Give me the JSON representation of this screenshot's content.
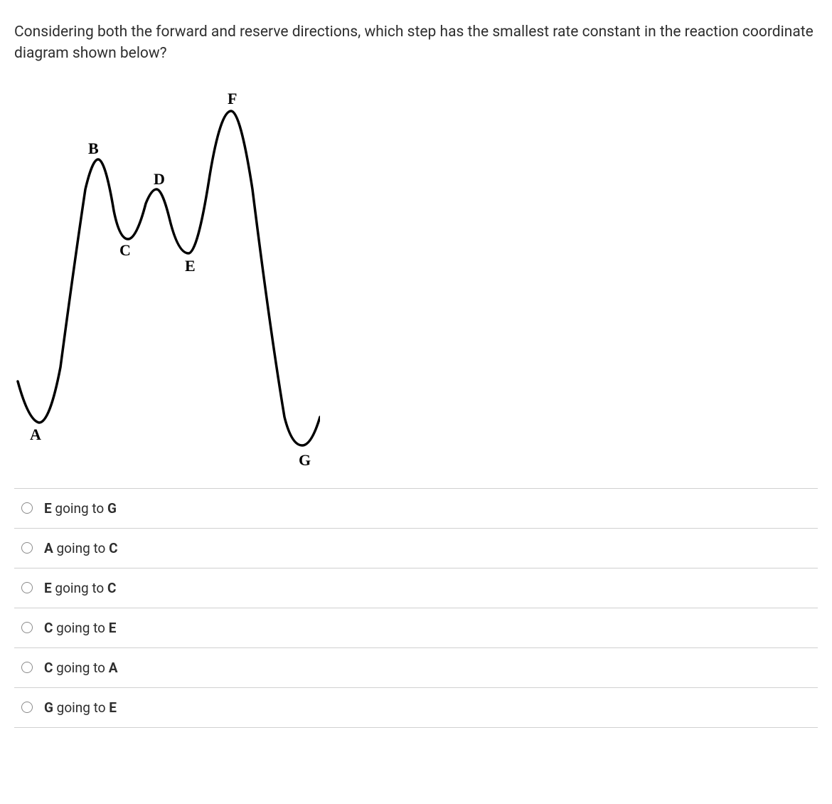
{
  "question": "Considering both the forward and reserve directions, which step has the smallest rate constant in the reaction coordinate diagram shown below?",
  "diagram": {
    "labels": {
      "A": "A",
      "B": "B",
      "C": "C",
      "D": "D",
      "E": "E",
      "F": "F",
      "G": "G"
    }
  },
  "options": [
    {
      "start": "E",
      "connector": " going to ",
      "end": "G"
    },
    {
      "start": "A",
      "connector": " going to ",
      "end": "C"
    },
    {
      "start": "E",
      "connector": " going to ",
      "end": "C"
    },
    {
      "start": "C",
      "connector": " going to ",
      "end": "E"
    },
    {
      "start": "C",
      "connector": " going to ",
      "end": "A"
    },
    {
      "start": "G",
      "connector": " going to ",
      "end": "E"
    }
  ]
}
